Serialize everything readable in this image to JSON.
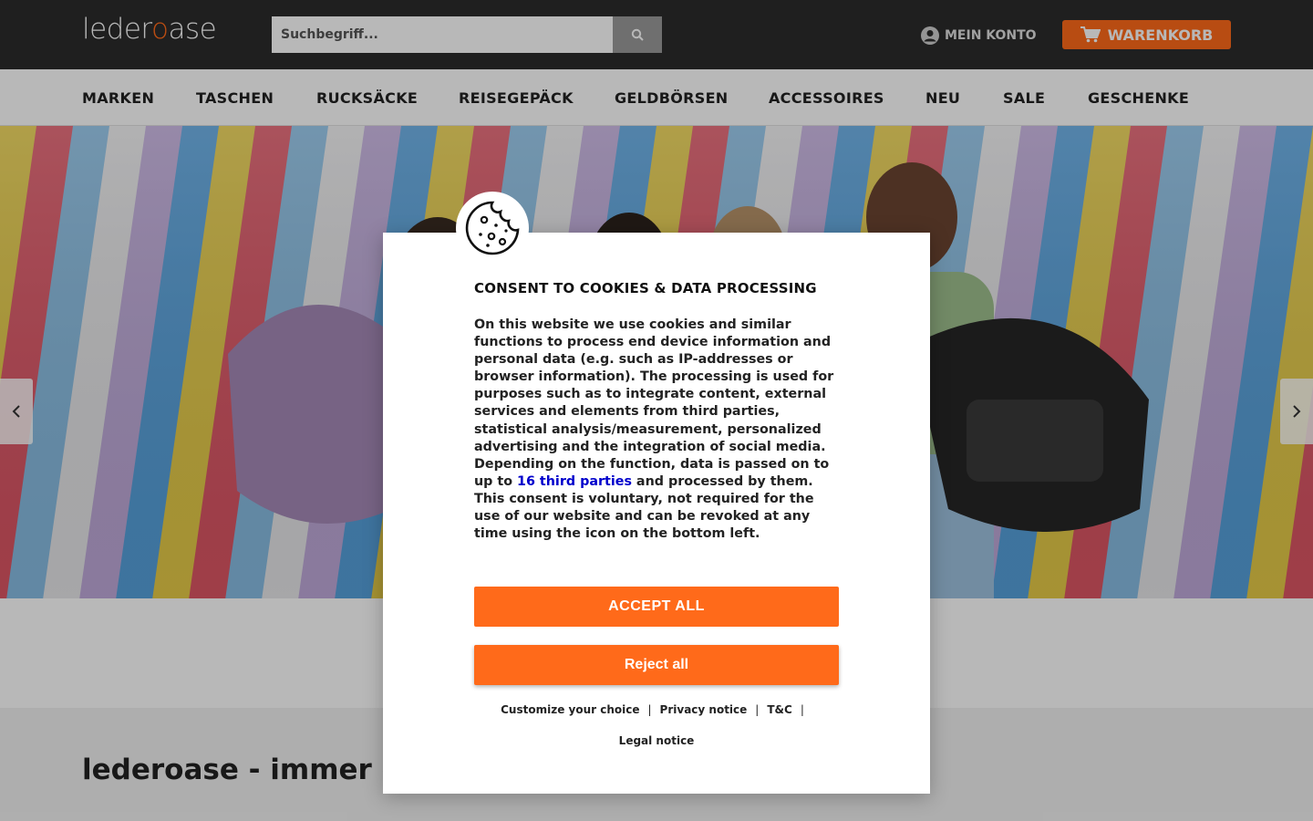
{
  "header": {
    "logo_part1": "leder",
    "logo_o": "o",
    "logo_part2": "ase",
    "search_placeholder": "Suchbegriff...",
    "account_label": "MEIN KONTO",
    "cart_label": "WARENKORB",
    "accent_color": "#ff6a1a"
  },
  "nav": {
    "items": [
      "MARKEN",
      "TASCHEN",
      "RUCKSÄCKE",
      "REISEGEPÄCK",
      "GELDBÖRSEN",
      "ACCESSOIRES",
      "NEU",
      "SALE",
      "GESCHENKE"
    ]
  },
  "hero": {
    "prev_icon": "chevron-left-icon",
    "next_icon": "chevron-right-icon"
  },
  "intro": {
    "heading": "lederoase - immer e"
  },
  "consent": {
    "title": "CONSENT TO COOKIES & DATA PROCESSING",
    "body_before_link": "On this website we use cookies and similar functions to process end device information and personal data (e.g. such as IP-addresses or browser information). The processing is used for purposes such as to integrate content, external services and elements from third parties, statistical analysis/measurement, personalized advertising and the integration of social media. Depending on the function, data is passed on to up to ",
    "body_link": "16 third parties",
    "body_after_link": " and processed by them. This consent is voluntary, not required for the use of our website and can be revoked at any time using the icon on the bottom left.",
    "accept_label": "ACCEPT ALL",
    "reject_label": "Reject all",
    "links": {
      "customize": "Customize your choice",
      "privacy": "Privacy notice",
      "tc": "T&C",
      "legal": "Legal notice",
      "separator": "|"
    }
  }
}
